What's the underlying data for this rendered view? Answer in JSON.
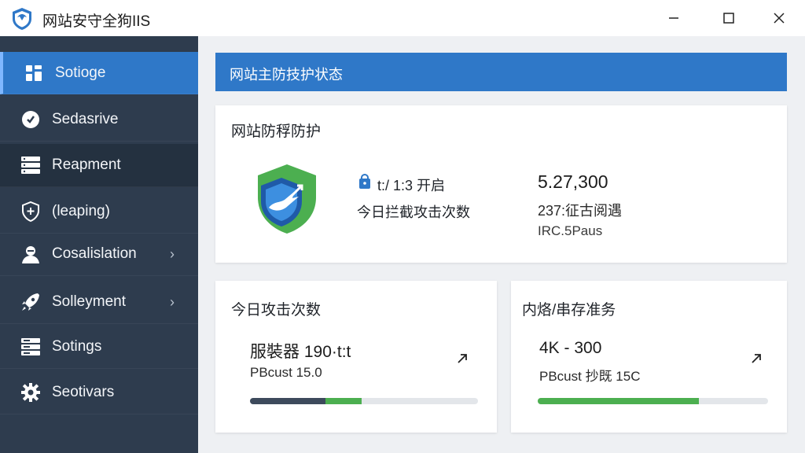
{
  "window": {
    "title": "网站安守全狗IIS",
    "colors": {
      "accent": "#2f78c8",
      "sidebar": "#2e3c4e",
      "green": "#4caf50",
      "dark_progress": "#3d4a5c"
    }
  },
  "sidebar": {
    "items": [
      {
        "label": "Sotioge",
        "icon": "dashboard-icon",
        "active": true
      },
      {
        "label": "Sedasrive",
        "icon": "check-circle-icon"
      },
      {
        "label": "Reapment",
        "icon": "server-icon"
      },
      {
        "label": "(leaping)",
        "icon": "shield-plus-icon"
      },
      {
        "label": "Cosalislation",
        "icon": "user-icon",
        "chevron": "›"
      },
      {
        "label": "Solleyment",
        "icon": "rocket-icon",
        "chevron": "›"
      },
      {
        "label": "Sotings",
        "icon": "database-icon"
      },
      {
        "label": "Seotivars",
        "icon": "gear-icon"
      }
    ]
  },
  "main": {
    "banner_title": "网站主防技护状态",
    "protection_card": {
      "title": "网站防稃防护",
      "status_line": "t:/ 1:3 开启",
      "intercept_label": "今日拦截攻击次数",
      "big_number": "5.27,300",
      "sub_line_1": "237:征古阅遇",
      "sub_line_2": "IRC.5Paus"
    },
    "attack_card": {
      "title": "今日攻击次数",
      "stat_main": "服裝器 190·t:t",
      "stat_sub": "PBcust 15.0",
      "progress": {
        "dark_fraction": 0.33,
        "green_fraction": 0.16
      }
    },
    "memory_card": {
      "title": "内烙/串存准务",
      "stat_main": "4K - 300",
      "stat_sub": "PBcust 抄既 15C",
      "progress": {
        "green_fraction": 0.7
      }
    }
  }
}
